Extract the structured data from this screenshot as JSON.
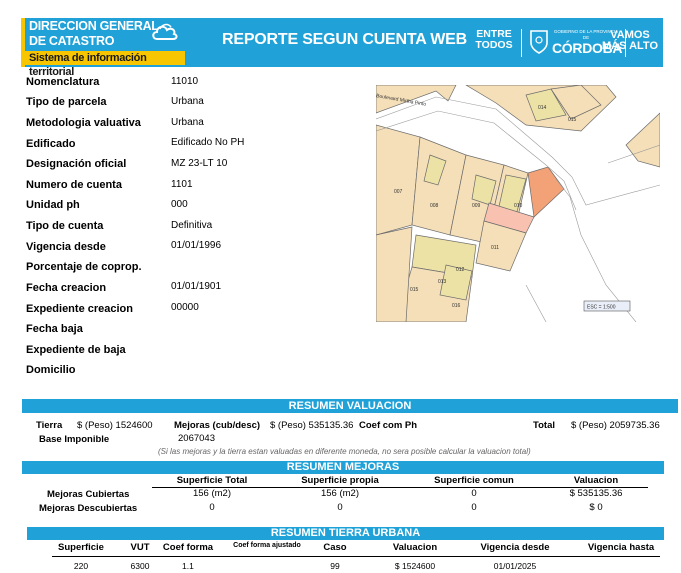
{
  "header": {
    "org_line1": "DIRECCION GENERAL",
    "org_line2": "DE CATASTRO",
    "org_line3": "Sistema de información territorial",
    "title": "REPORTE SEGUN CUENTA WEB",
    "brand_entre_line1": "ENTRE",
    "brand_entre_line2": "TODOS",
    "brand_cordoba_small": "GOBIERNO DE LA PROVINCIA DE",
    "brand_cordoba": "CÓRDOBA",
    "brand_vamos_line1": "VAMOS",
    "brand_vamos_line2": "MÁS ALTO",
    "colors": {
      "primary": "#20a2d8",
      "accent": "#f7c600"
    }
  },
  "info": {
    "fields": [
      {
        "label": "Nomenclatura",
        "value": "11010"
      },
      {
        "label": "Tipo de parcela",
        "value": "Urbana"
      },
      {
        "label": "Metodologia valuativa",
        "value": "Urbana"
      },
      {
        "label": "Edificado",
        "value": "Edificado No PH"
      },
      {
        "label": "Designación oficial",
        "value": "MZ 23-LT 10"
      },
      {
        "label": "Numero de cuenta",
        "value": "1101"
      },
      {
        "label": "Unidad ph",
        "value": "000"
      },
      {
        "label": "Tipo de cuenta",
        "value": "Definitiva"
      },
      {
        "label": "Vigencia desde",
        "value": "01/01/1996"
      },
      {
        "label": "Porcentaje de coprop.",
        "value": ""
      },
      {
        "label": "Fecha creacion",
        "value": "01/01/1901"
      },
      {
        "label": "Expediente creacion",
        "value": "00000"
      },
      {
        "label": "Fecha baja",
        "value": ""
      },
      {
        "label": "Expediente de baja",
        "value": ""
      },
      {
        "label": "Domicilio",
        "value": ""
      }
    ]
  },
  "map": {
    "street_label": "Boulevard Mirtha Pinto",
    "lots": [
      "007",
      "008",
      "009",
      "010",
      "011",
      "012",
      "013",
      "015",
      "016",
      "015",
      "014"
    ],
    "scale": "ESC = 1:500"
  },
  "valuacion": {
    "title": "RESUMEN VALUACION",
    "tierra_label": "Tierra",
    "tierra_value": "$ (Peso) 1524600",
    "mejoras_label": "Mejoras (cub/desc)",
    "mejoras_value": "$ (Peso) 535135.36",
    "coef_label": "Coef com Ph",
    "total_label": "Total",
    "total_value": "$ (Peso) 2059735.36",
    "base_label": "Base Imponible",
    "base_value": "2067043",
    "note": "(Si las mejoras y la tierra estan valuadas en diferente moneda, no sera posible calcular la valuacion total)"
  },
  "mejoras": {
    "title": "RESUMEN MEJORAS",
    "columns": [
      "Superficie Total",
      "Superficie propia",
      "Superficie comun",
      "Valuacion"
    ],
    "rows": [
      {
        "label": "Mejoras Cubiertas",
        "cells": [
          "156 (m2)",
          "156 (m2)",
          "0",
          "$ 535135.36"
        ]
      },
      {
        "label": "Mejoras Descubiertas",
        "cells": [
          "0",
          "0",
          "0",
          "$ 0"
        ]
      }
    ]
  },
  "tierra": {
    "title": "RESUMEN TIERRA URBANA",
    "columns": [
      "Superficie",
      "VUT",
      "Coef forma",
      "Coef forma ajustado",
      "Caso",
      "Valuacion",
      "Vigencia desde",
      "Vigencia hasta"
    ],
    "row": [
      "220",
      "6300",
      "1.1",
      "",
      "99",
      "$ 1524600",
      "01/01/2025",
      ""
    ]
  }
}
